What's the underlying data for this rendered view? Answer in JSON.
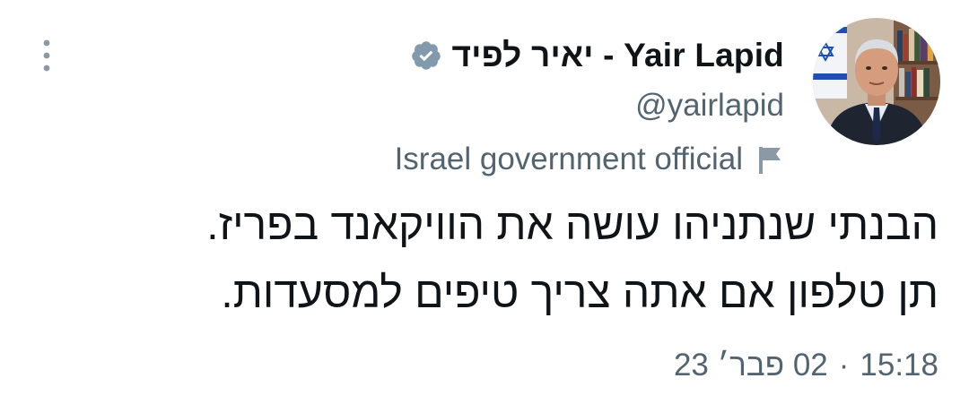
{
  "author": {
    "display_name": "יאיר לפיד - Yair Lapid",
    "handle": "@yairlapid",
    "label": "Israel government official",
    "avatar_icon": "profile-photo",
    "verified_icon": "verified-badge-icon",
    "label_icon": "flag-icon"
  },
  "tweet": {
    "text": "הבנתי שנתניהו עושה את הוויקאנד בפריז.\nתן טלפון אם אתה צריך טיפים למסעדות.",
    "time": "15:18",
    "separator": "·",
    "date": "02 פבר׳ 23"
  },
  "menu": {
    "icon": "more-options-icon"
  },
  "colors": {
    "text": "#0f1419",
    "secondary": "#536471",
    "verified_badge": "#829aab",
    "background": "#ffffff"
  }
}
